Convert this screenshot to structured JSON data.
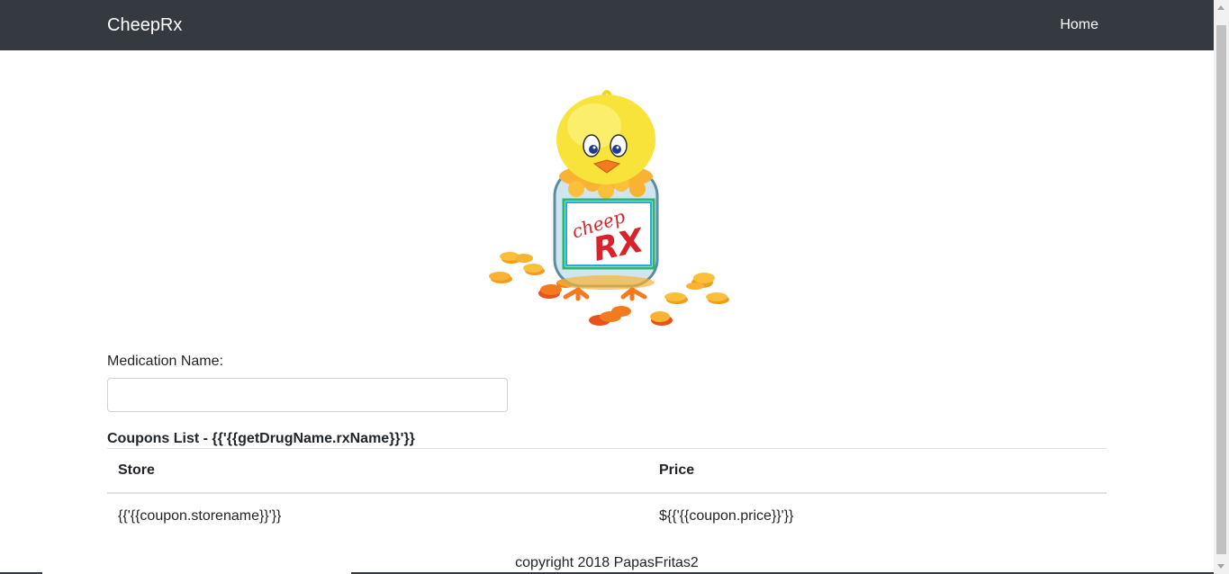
{
  "navbar": {
    "brand": "CheepRx",
    "home_label": "Home"
  },
  "logo": {
    "label_line1": "cheep",
    "label_line2": "RX"
  },
  "form": {
    "medication_label": "Medication Name:",
    "medication_value": "",
    "medication_placeholder": ""
  },
  "coupons": {
    "heading": "Coupons List - {{'{{getDrugName.rxName}}'}}",
    "columns": [
      "Store",
      "Price"
    ],
    "rows": [
      [
        "{{'{{coupon.storename}}'}}",
        "${{'{{coupon.price}}'}}"
      ]
    ]
  },
  "footer": {
    "text": "copyright 2018 PapasFritas2"
  },
  "colors": {
    "navbar_bg": "#343a40",
    "chick_yellow": "#f7e33a",
    "coin_orange": "#f6a623",
    "label_red": "#d8232a"
  }
}
